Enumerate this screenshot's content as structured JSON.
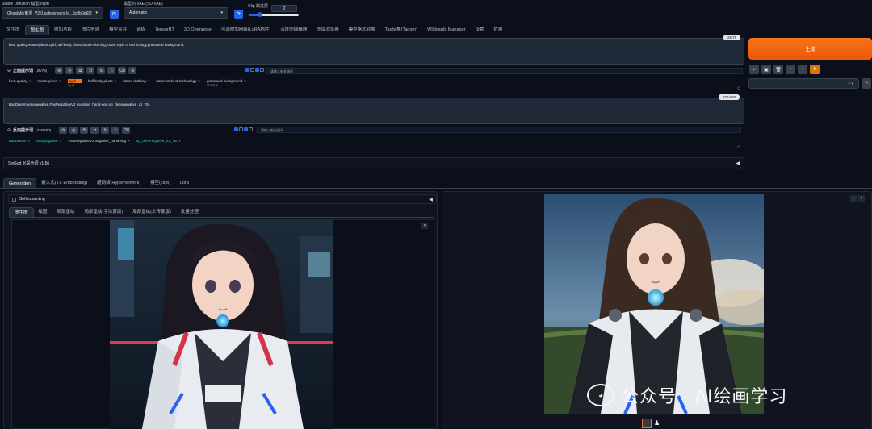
{
  "top": {
    "model_label": "Stable Diffusion 模型(ckpt)",
    "model_value": "GhostMix鬼混_V2.0.safetensors [d...5c9b0e68]",
    "vae_label": "模型的 VAE (SD VAE)",
    "vae_value": "Automatic",
    "clip_label": "Clip 跳过层",
    "clip_value": "2",
    "refresh_icon": "refresh-icon"
  },
  "main_tabs": [
    "文生图",
    "图生图",
    "附加功能",
    "图片信息",
    "模型合并",
    "训练",
    "TensorRT",
    "3D Openpose",
    "可选附加网络(LoRA插件)",
    "深度图编辑器",
    "图库浏览器",
    "模型格式转换",
    "Tag反推(Tagger)",
    "Wildcards Manager",
    "设置",
    "扩展"
  ],
  "active_main_tab_index": 1,
  "prompt": {
    "text": "best quality,masterpiece,1girl,half-body photo,future clothing,future style of technology,grassland background,",
    "counter": "25/75",
    "section_label": "正面提示词",
    "section_count": "(25/75)",
    "search_placeholder": "请输入新关键词",
    "tags": [
      {
        "text": "best quality",
        "sub": ""
      },
      {
        "text": "masterpiece",
        "sub": ""
      },
      {
        "text": "1girl",
        "sub": "1女孩"
      },
      {
        "text": "half-body photo",
        "sub": ""
      },
      {
        "text": "future clothing",
        "sub": ""
      },
      {
        "text": "future style of technology",
        "sub": ""
      },
      {
        "text": "grassland background",
        "sub": "草地背景"
      }
    ]
  },
  "negative": {
    "text": "BadDream,easynegative,FastNegativeV2 negative_hand-neg,ng_deepnegative_v1_75t,",
    "counter": "376/450",
    "section_label": "反向提示词",
    "section_count": "(376/450)",
    "search_placeholder": "请输入新关键词",
    "tags": [
      {
        "text": "BadDream",
        "teal": true
      },
      {
        "text": "easynegative",
        "teal": true
      },
      {
        "text": "FastNegativeV2 negative_hand-neg",
        "teal": false
      },
      {
        "text": "ng_deepnegative_v1_75t",
        "teal": true
      }
    ]
  },
  "sixgod": {
    "label": "SixGod_K提示词 v1.66"
  },
  "extra_tabs": [
    "Generation",
    "嵌入式(T.I. Embedding)",
    "超网络(Hypernetwork)",
    "模型(ckpt)",
    "Lora"
  ],
  "soft_inpainting": {
    "label": "Soft inpainting"
  },
  "img_tabs": [
    "图生图",
    "绘图",
    "局部重绘",
    "局部重绘(手涂蒙版)",
    "局部重绘(上传蒙版)",
    "批量处理"
  ],
  "generate": {
    "label": "生成"
  },
  "watermark": {
    "text": "公众号 · AI绘画学习"
  },
  "colors": {
    "bg": "#0b0f19",
    "accent": "#f97316",
    "blue": "#2563eb"
  }
}
